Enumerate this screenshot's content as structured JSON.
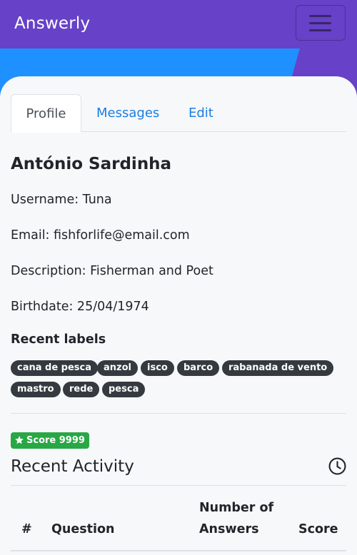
{
  "navbar": {
    "brand": "Answerly",
    "toggle_icon": "hamburger-menu-icon",
    "background": "#6741c7"
  },
  "tabs": [
    {
      "label": "Profile",
      "active": true
    },
    {
      "label": "Messages",
      "active": false
    },
    {
      "label": "Edit",
      "active": false
    }
  ],
  "profile": {
    "name": "António Sardinha",
    "username": "Username: Tuna",
    "email": "Email: fishforlife@email.com",
    "description": "Description: Fisherman and Poet",
    "birthdate": "Birthdate: 25/04/1974"
  },
  "recent_labels": {
    "title": "Recent labels",
    "items": [
      "cana de pesca",
      "anzol",
      "isco",
      "barco",
      "rabanada de vento",
      "mastro",
      "rede",
      "pesca"
    ]
  },
  "score": {
    "icon": "star-icon",
    "text": "Score 9999",
    "color": "#28a745"
  },
  "activity": {
    "title": "Recent Activity",
    "icon": "clock-icon",
    "columns": [
      "#",
      "Question",
      "Number of Answers",
      "Score"
    ]
  },
  "colors": {
    "accent": "#1a7ee6",
    "pill": "#343a40"
  }
}
